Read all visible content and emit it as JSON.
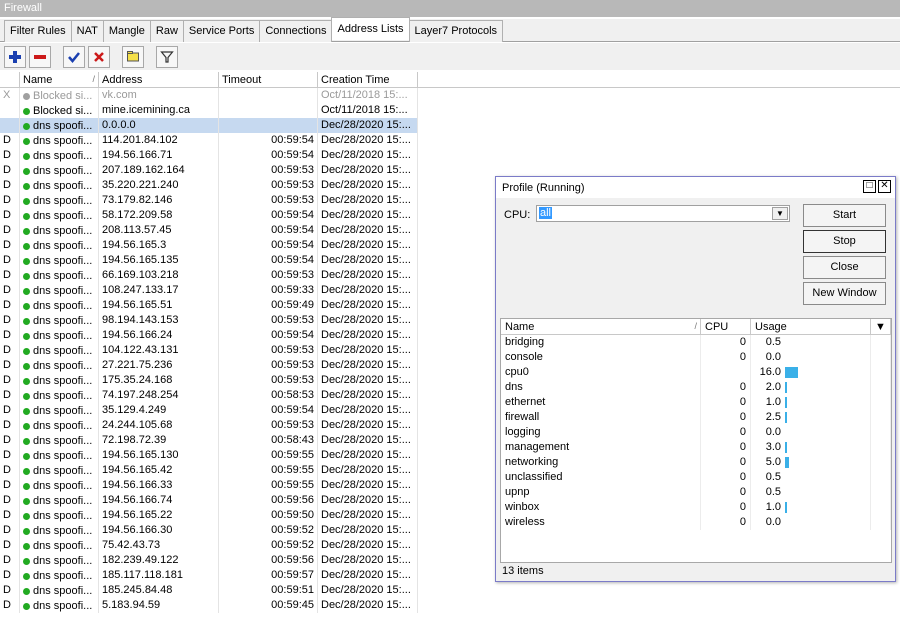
{
  "window_title": "Firewall",
  "tabs": [
    "Filter Rules",
    "NAT",
    "Mangle",
    "Raw",
    "Service Ports",
    "Connections",
    "Address Lists",
    "Layer7 Protocols"
  ],
  "active_tab": "Address Lists",
  "toolbar_icons": [
    "plus-icon",
    "minus-icon",
    "check-icon",
    "cross-icon",
    "comment-icon",
    "filter-icon"
  ],
  "columns": [
    "Name",
    "Address",
    "Timeout",
    "Creation Time"
  ],
  "rows": [
    {
      "flag": "X",
      "name": "Blocked si...",
      "address": "vk.com",
      "timeout": "",
      "created": "Oct/11/2018 15:...",
      "state": "disabled"
    },
    {
      "flag": "",
      "name": "Blocked si...",
      "address": "mine.icemining.ca",
      "timeout": "",
      "created": "Oct/11/2018 15:...",
      "state": "normal"
    },
    {
      "flag": "",
      "name": "dns spoofi...",
      "address": "0.0.0.0",
      "timeout": "",
      "created": "Dec/28/2020 15:...",
      "state": "selected"
    },
    {
      "flag": "D",
      "name": "dns spoofi...",
      "address": "114.201.84.102",
      "timeout": "00:59:54",
      "created": "Dec/28/2020 15:...",
      "state": "normal"
    },
    {
      "flag": "D",
      "name": "dns spoofi...",
      "address": "194.56.166.71",
      "timeout": "00:59:54",
      "created": "Dec/28/2020 15:...",
      "state": "normal"
    },
    {
      "flag": "D",
      "name": "dns spoofi...",
      "address": "207.189.162.164",
      "timeout": "00:59:53",
      "created": "Dec/28/2020 15:...",
      "state": "normal"
    },
    {
      "flag": "D",
      "name": "dns spoofi...",
      "address": "35.220.221.240",
      "timeout": "00:59:53",
      "created": "Dec/28/2020 15:...",
      "state": "normal"
    },
    {
      "flag": "D",
      "name": "dns spoofi...",
      "address": "73.179.82.146",
      "timeout": "00:59:53",
      "created": "Dec/28/2020 15:...",
      "state": "normal"
    },
    {
      "flag": "D",
      "name": "dns spoofi...",
      "address": "58.172.209.58",
      "timeout": "00:59:54",
      "created": "Dec/28/2020 15:...",
      "state": "normal"
    },
    {
      "flag": "D",
      "name": "dns spoofi...",
      "address": "208.113.57.45",
      "timeout": "00:59:54",
      "created": "Dec/28/2020 15:...",
      "state": "normal"
    },
    {
      "flag": "D",
      "name": "dns spoofi...",
      "address": "194.56.165.3",
      "timeout": "00:59:54",
      "created": "Dec/28/2020 15:...",
      "state": "normal"
    },
    {
      "flag": "D",
      "name": "dns spoofi...",
      "address": "194.56.165.135",
      "timeout": "00:59:54",
      "created": "Dec/28/2020 15:...",
      "state": "normal"
    },
    {
      "flag": "D",
      "name": "dns spoofi...",
      "address": "66.169.103.218",
      "timeout": "00:59:53",
      "created": "Dec/28/2020 15:...",
      "state": "normal"
    },
    {
      "flag": "D",
      "name": "dns spoofi...",
      "address": "108.247.133.17",
      "timeout": "00:59:33",
      "created": "Dec/28/2020 15:...",
      "state": "normal"
    },
    {
      "flag": "D",
      "name": "dns spoofi...",
      "address": "194.56.165.51",
      "timeout": "00:59:49",
      "created": "Dec/28/2020 15:...",
      "state": "normal"
    },
    {
      "flag": "D",
      "name": "dns spoofi...",
      "address": "98.194.143.153",
      "timeout": "00:59:53",
      "created": "Dec/28/2020 15:...",
      "state": "normal"
    },
    {
      "flag": "D",
      "name": "dns spoofi...",
      "address": "194.56.166.24",
      "timeout": "00:59:54",
      "created": "Dec/28/2020 15:...",
      "state": "normal"
    },
    {
      "flag": "D",
      "name": "dns spoofi...",
      "address": "104.122.43.131",
      "timeout": "00:59:53",
      "created": "Dec/28/2020 15:...",
      "state": "normal"
    },
    {
      "flag": "D",
      "name": "dns spoofi...",
      "address": "27.221.75.236",
      "timeout": "00:59:53",
      "created": "Dec/28/2020 15:...",
      "state": "normal"
    },
    {
      "flag": "D",
      "name": "dns spoofi...",
      "address": "175.35.24.168",
      "timeout": "00:59:53",
      "created": "Dec/28/2020 15:...",
      "state": "normal"
    },
    {
      "flag": "D",
      "name": "dns spoofi...",
      "address": "74.197.248.254",
      "timeout": "00:58:53",
      "created": "Dec/28/2020 15:...",
      "state": "normal"
    },
    {
      "flag": "D",
      "name": "dns spoofi...",
      "address": "35.129.4.249",
      "timeout": "00:59:54",
      "created": "Dec/28/2020 15:...",
      "state": "normal"
    },
    {
      "flag": "D",
      "name": "dns spoofi...",
      "address": "24.244.105.68",
      "timeout": "00:59:53",
      "created": "Dec/28/2020 15:...",
      "state": "normal"
    },
    {
      "flag": "D",
      "name": "dns spoofi...",
      "address": "72.198.72.39",
      "timeout": "00:58:43",
      "created": "Dec/28/2020 15:...",
      "state": "normal"
    },
    {
      "flag": "D",
      "name": "dns spoofi...",
      "address": "194.56.165.130",
      "timeout": "00:59:55",
      "created": "Dec/28/2020 15:...",
      "state": "normal"
    },
    {
      "flag": "D",
      "name": "dns spoofi...",
      "address": "194.56.165.42",
      "timeout": "00:59:55",
      "created": "Dec/28/2020 15:...",
      "state": "normal"
    },
    {
      "flag": "D",
      "name": "dns spoofi...",
      "address": "194.56.166.33",
      "timeout": "00:59:55",
      "created": "Dec/28/2020 15:...",
      "state": "normal"
    },
    {
      "flag": "D",
      "name": "dns spoofi...",
      "address": "194.56.166.74",
      "timeout": "00:59:56",
      "created": "Dec/28/2020 15:...",
      "state": "normal"
    },
    {
      "flag": "D",
      "name": "dns spoofi...",
      "address": "194.56.165.22",
      "timeout": "00:59:50",
      "created": "Dec/28/2020 15:...",
      "state": "normal"
    },
    {
      "flag": "D",
      "name": "dns spoofi...",
      "address": "194.56.166.30",
      "timeout": "00:59:52",
      "created": "Dec/28/2020 15:...",
      "state": "normal"
    },
    {
      "flag": "D",
      "name": "dns spoofi...",
      "address": "75.42.43.73",
      "timeout": "00:59:52",
      "created": "Dec/28/2020 15:...",
      "state": "normal"
    },
    {
      "flag": "D",
      "name": "dns spoofi...",
      "address": "182.239.49.122",
      "timeout": "00:59:56",
      "created": "Dec/28/2020 15:...",
      "state": "normal"
    },
    {
      "flag": "D",
      "name": "dns spoofi...",
      "address": "185.117.118.181",
      "timeout": "00:59:57",
      "created": "Dec/28/2020 15:...",
      "state": "normal"
    },
    {
      "flag": "D",
      "name": "dns spoofi...",
      "address": "185.245.84.48",
      "timeout": "00:59:51",
      "created": "Dec/28/2020 15:...",
      "state": "normal"
    },
    {
      "flag": "D",
      "name": "dns spoofi...",
      "address": "5.183.94.59",
      "timeout": "00:59:45",
      "created": "Dec/28/2020 15:...",
      "state": "normal"
    }
  ],
  "profile": {
    "title": "Profile (Running)",
    "cpu_label": "CPU:",
    "cpu_value": "all",
    "buttons": {
      "start": "Start",
      "stop": "Stop",
      "close": "Close",
      "new_window": "New Window"
    },
    "columns": [
      "Name",
      "CPU",
      "Usage"
    ],
    "items": [
      {
        "name": "bridging",
        "cpu": "0",
        "usage": "0.5"
      },
      {
        "name": "console",
        "cpu": "0",
        "usage": "0.0"
      },
      {
        "name": "cpu0",
        "cpu": "",
        "usage": "16.0"
      },
      {
        "name": "dns",
        "cpu": "0",
        "usage": "2.0"
      },
      {
        "name": "ethernet",
        "cpu": "0",
        "usage": "1.0"
      },
      {
        "name": "firewall",
        "cpu": "0",
        "usage": "2.5"
      },
      {
        "name": "logging",
        "cpu": "0",
        "usage": "0.0"
      },
      {
        "name": "management",
        "cpu": "0",
        "usage": "3.0"
      },
      {
        "name": "networking",
        "cpu": "0",
        "usage": "5.0"
      },
      {
        "name": "unclassified",
        "cpu": "0",
        "usage": "0.5"
      },
      {
        "name": "upnp",
        "cpu": "0",
        "usage": "0.5"
      },
      {
        "name": "winbox",
        "cpu": "0",
        "usage": "1.0"
      },
      {
        "name": "wireless",
        "cpu": "0",
        "usage": "0.0"
      }
    ],
    "footer": "13 items"
  },
  "colors": {
    "accent_green": "#22aa22",
    "usage_bar": "#3ab0e8",
    "selection": "#c6d9f0"
  }
}
